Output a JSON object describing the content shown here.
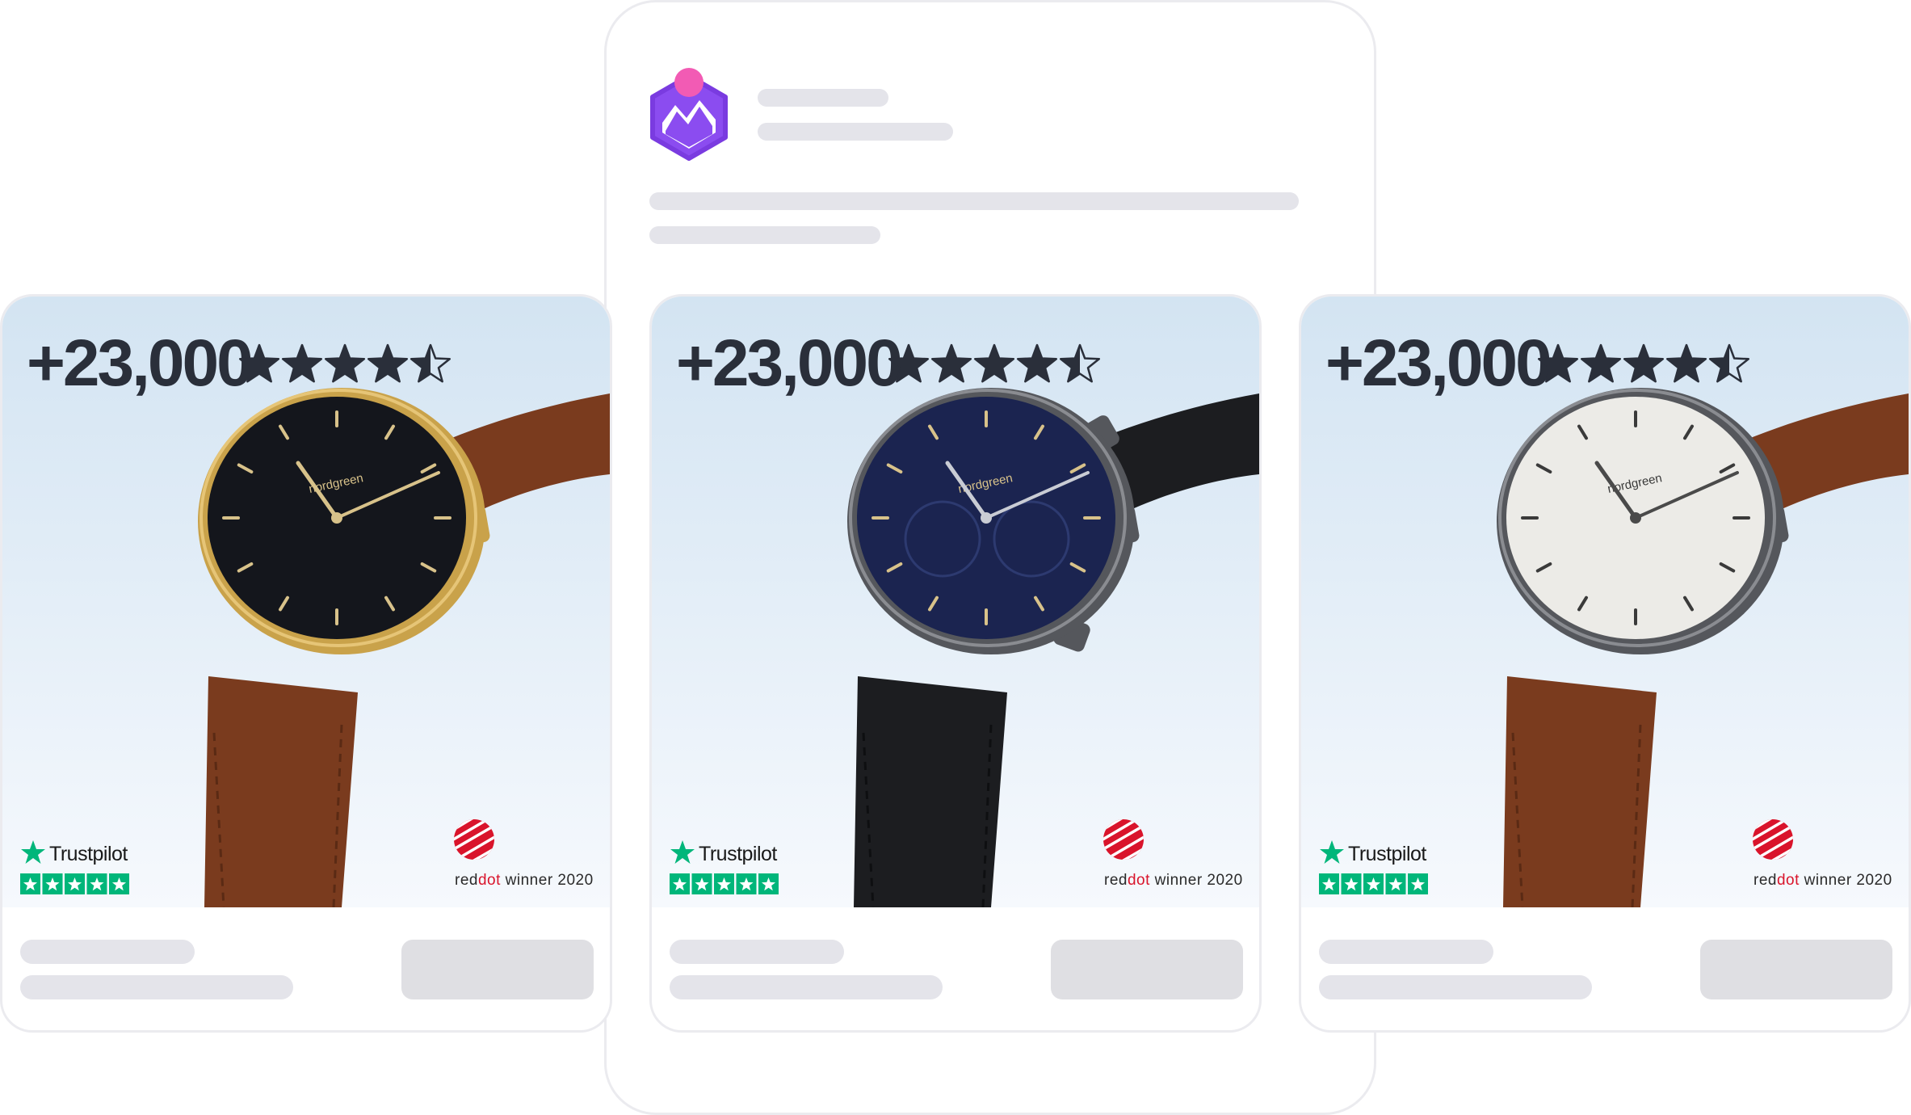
{
  "colors": {
    "app_logo_primary": "#8b4cf0",
    "app_logo_dot": "#f25bb4",
    "skeleton": "#e4e4ea",
    "trustpilot_green": "#00b67a",
    "reddot_red": "#d9142b",
    "count_text": "#2a2f3a"
  },
  "header": {
    "logo_icon": "app-chart-logo-icon"
  },
  "cards": [
    {
      "count": "+23,000",
      "rating": 4.5,
      "watch": {
        "case": "gold",
        "dial": "black",
        "strap": "brown-leather",
        "brand": "nordgreen"
      },
      "trustpilot": {
        "label": "Trustpilot"
      },
      "reddot": {
        "prefix": "red",
        "dot": "dot",
        "suffix": " winner 2020"
      }
    },
    {
      "count": "+23,000",
      "rating": 4.5,
      "watch": {
        "case": "gunmetal",
        "dial": "navy-chronograph",
        "strap": "black-leather",
        "brand": "nordgreen"
      },
      "trustpilot": {
        "label": "Trustpilot"
      },
      "reddot": {
        "prefix": "red",
        "dot": "dot",
        "suffix": " winner 2020"
      }
    },
    {
      "count": "+23,000",
      "rating": 4.5,
      "watch": {
        "case": "gunmetal",
        "dial": "white",
        "strap": "brown-leather",
        "brand": "nordgreen"
      },
      "trustpilot": {
        "label": "Trustpilot"
      },
      "reddot": {
        "prefix": "red",
        "dot": "dot",
        "suffix": " winner 2020"
      }
    }
  ],
  "watch_brand_text": "nordgreen"
}
